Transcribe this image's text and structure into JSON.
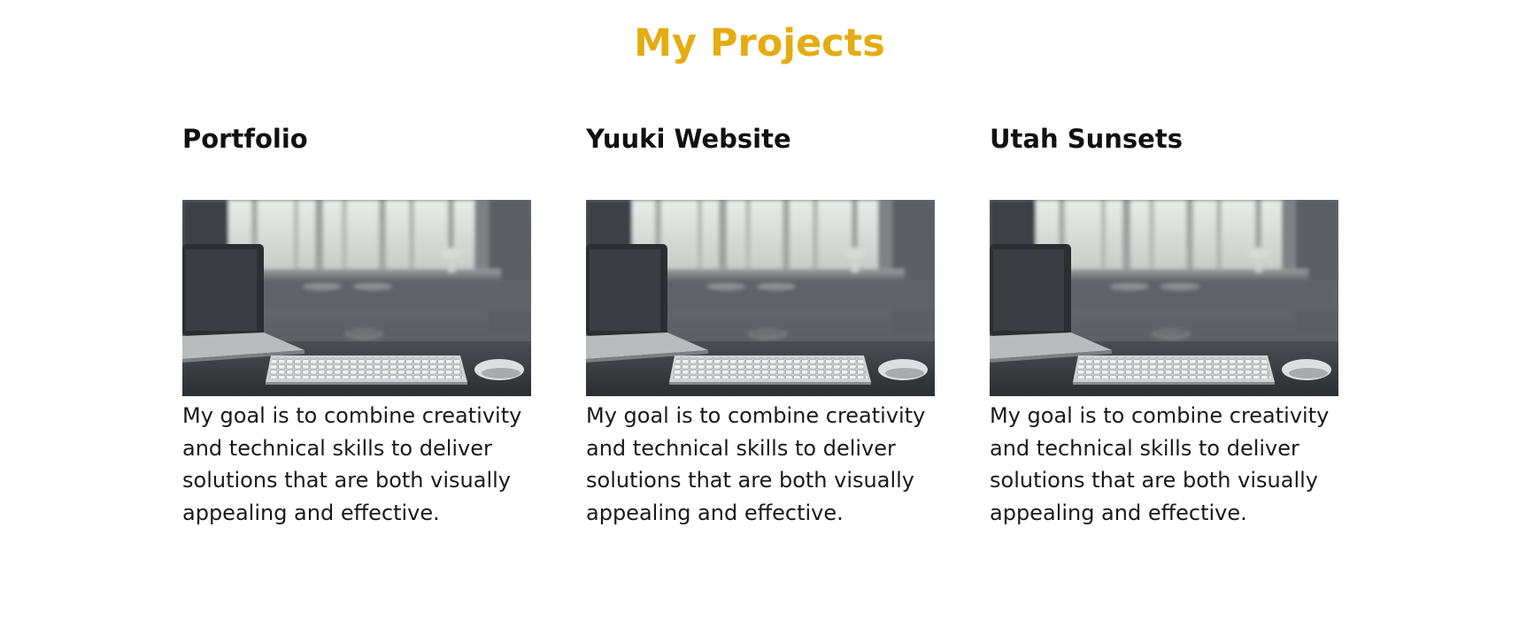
{
  "page": {
    "heading": "My Projects",
    "accent_color": "#e5ac12"
  },
  "projects": [
    {
      "title": "Portfolio",
      "image": "desk-keyboard-laptop-photo",
      "description": "My goal is to combine creativity and technical skills to deliver solutions that are both visually appealing and effective."
    },
    {
      "title": "Yuuki Website",
      "image": "desk-keyboard-laptop-photo",
      "description": "My goal is to combine creativity and technical skills to deliver solutions that are both visually appealing and effective."
    },
    {
      "title": "Utah Sunsets",
      "image": "desk-keyboard-laptop-photo",
      "description": "My goal is to combine creativity and technical skills to deliver solutions that are both visually appealing and effective."
    }
  ]
}
